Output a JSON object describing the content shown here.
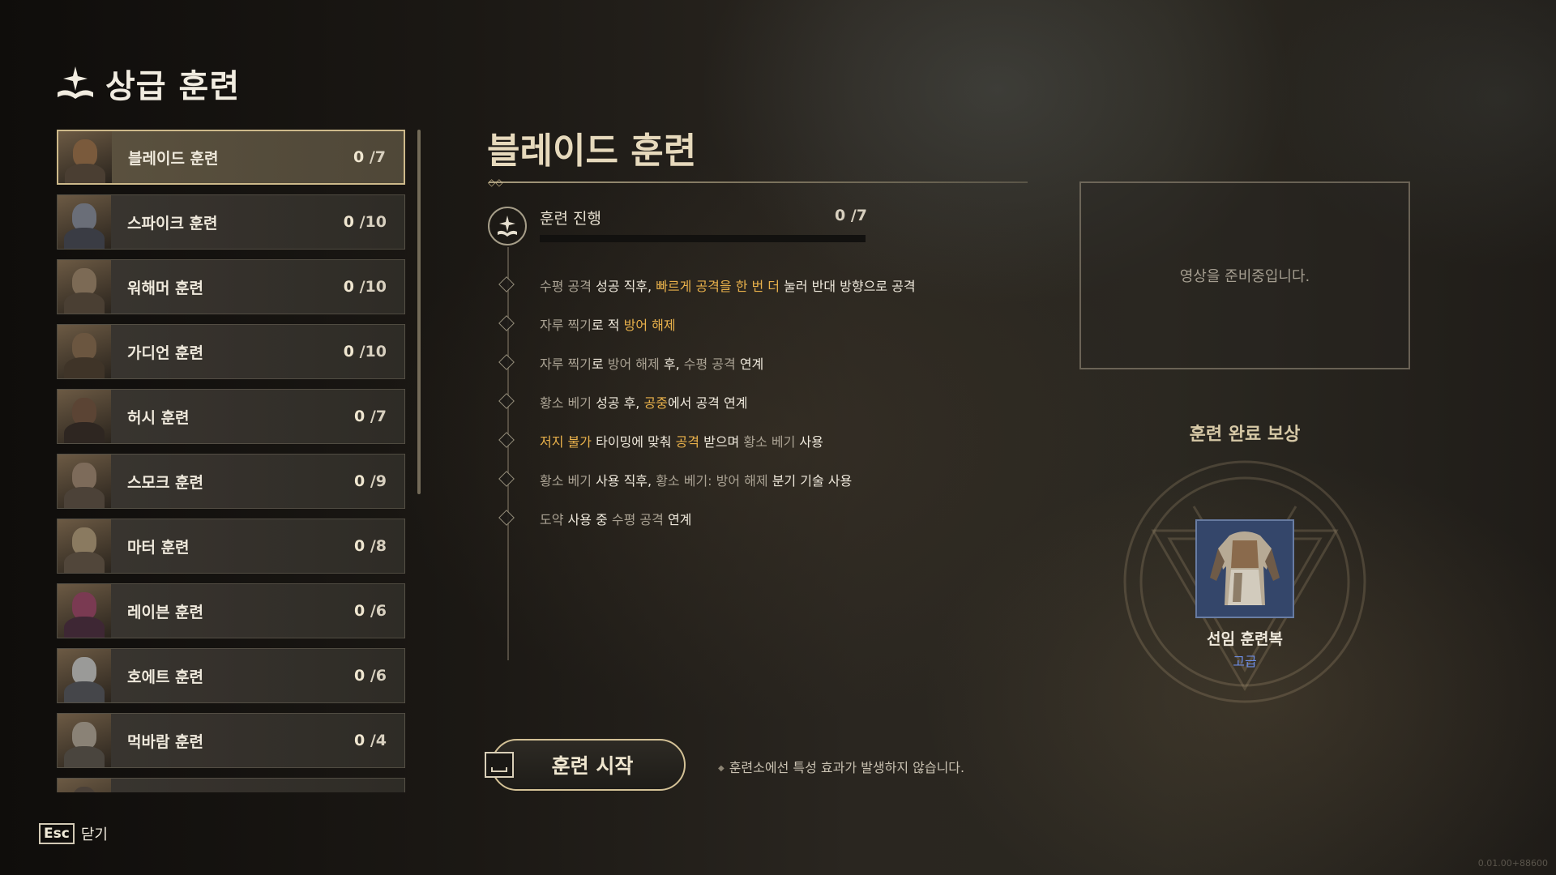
{
  "header": {
    "title": "상급 훈련"
  },
  "trainings": [
    {
      "name": "블레이드 훈련",
      "current": "0",
      "total": "/7",
      "selected": true
    },
    {
      "name": "스파이크 훈련",
      "current": "0",
      "total": "/10"
    },
    {
      "name": "워해머 훈련",
      "current": "0",
      "total": "/10"
    },
    {
      "name": "가디언 훈련",
      "current": "0",
      "total": "/10"
    },
    {
      "name": "허시 훈련",
      "current": "0",
      "total": "/7"
    },
    {
      "name": "스모크 훈련",
      "current": "0",
      "total": "/9"
    },
    {
      "name": "마터 훈련",
      "current": "0",
      "total": "/8"
    },
    {
      "name": "레이븐 훈련",
      "current": "0",
      "total": "/6"
    },
    {
      "name": "호에트 훈련",
      "current": "0",
      "total": "/6"
    },
    {
      "name": "먹바람 훈련",
      "current": "0",
      "total": "/4"
    }
  ],
  "detail": {
    "title": "블레이드 훈련",
    "progress_label": "훈련 진행",
    "progress_current": "0",
    "progress_total": "/7",
    "progress_fraction": 0,
    "steps": [
      [
        {
          "t": "수평 공격 ",
          "c": "g"
        },
        {
          "t": "성공 직후, ",
          "c": "w"
        },
        {
          "t": "빠르게 공격을 한 번 더",
          "c": "y"
        },
        {
          "t": " 눌러 반대 방향으로 공격",
          "c": "w"
        }
      ],
      [
        {
          "t": "자루 찍기",
          "c": "g"
        },
        {
          "t": "로 적 ",
          "c": "w"
        },
        {
          "t": "방어 해제",
          "c": "y"
        }
      ],
      [
        {
          "t": "자루 찍기",
          "c": "g"
        },
        {
          "t": "로 ",
          "c": "w"
        },
        {
          "t": "방어 해제 ",
          "c": "g"
        },
        {
          "t": "후, ",
          "c": "w"
        },
        {
          "t": "수평 공격 ",
          "c": "g"
        },
        {
          "t": "연계",
          "c": "w"
        }
      ],
      [
        {
          "t": "황소 베기 ",
          "c": "g"
        },
        {
          "t": "성공 후, ",
          "c": "w"
        },
        {
          "t": "공중",
          "c": "y"
        },
        {
          "t": "에서 공격 연계",
          "c": "w"
        }
      ],
      [
        {
          "t": "저지 불가 ",
          "c": "y"
        },
        {
          "t": "타이밍에 맞춰 ",
          "c": "w"
        },
        {
          "t": "공격 ",
          "c": "y"
        },
        {
          "t": "받으며 ",
          "c": "w"
        },
        {
          "t": "황소 베기 ",
          "c": "g"
        },
        {
          "t": "사용",
          "c": "w"
        }
      ],
      [
        {
          "t": "황소 베기 ",
          "c": "g"
        },
        {
          "t": "사용 직후, ",
          "c": "w"
        },
        {
          "t": "황소 베기: 방어 해제 ",
          "c": "g"
        },
        {
          "t": "분기 기술 사용",
          "c": "w"
        }
      ],
      [
        {
          "t": "도약 ",
          "c": "g"
        },
        {
          "t": "사용 중 ",
          "c": "w"
        },
        {
          "t": "수평 공격 ",
          "c": "g"
        },
        {
          "t": "연계",
          "c": "w"
        }
      ]
    ],
    "start_button": "훈련 시작",
    "notice": "훈련소에선 특성 효과가 발생하지 않습니다."
  },
  "video": {
    "placeholder": "영상을 준비중입니다."
  },
  "reward": {
    "title": "훈련 완료 보상",
    "name": "선임 훈련복",
    "grade": "고급",
    "grade_color": "#6e8ee6"
  },
  "footer": {
    "esc_key": "Esc",
    "esc_label": "닫기",
    "version": "0.01.00+88600"
  },
  "colors": {
    "accent": "#c9b68a",
    "highlight": "#e9b14b"
  }
}
